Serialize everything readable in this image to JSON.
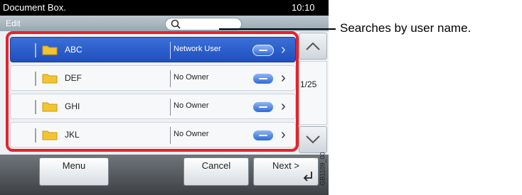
{
  "header": {
    "title": "Document Box.",
    "time": "10:10",
    "edit_label": "Edit"
  },
  "search": {
    "icon": "search-icon"
  },
  "rows": [
    {
      "name": "ABC",
      "owner": "Network User",
      "selected": true
    },
    {
      "name": "DEF",
      "owner": "No Owner",
      "selected": false
    },
    {
      "name": "GHI",
      "owner": "No Owner",
      "selected": false
    },
    {
      "name": "JKL",
      "owner": "No Owner",
      "selected": false
    }
  ],
  "scroll": {
    "page": "1/25"
  },
  "buttons": {
    "menu": "Menu",
    "cancel": "Cancel",
    "next": "Next >"
  },
  "figure_code": "GB1109_00",
  "callout": "Searches by user name.",
  "colors": {
    "highlight": "#e5222c",
    "selected_row": "#2a5bd0"
  }
}
